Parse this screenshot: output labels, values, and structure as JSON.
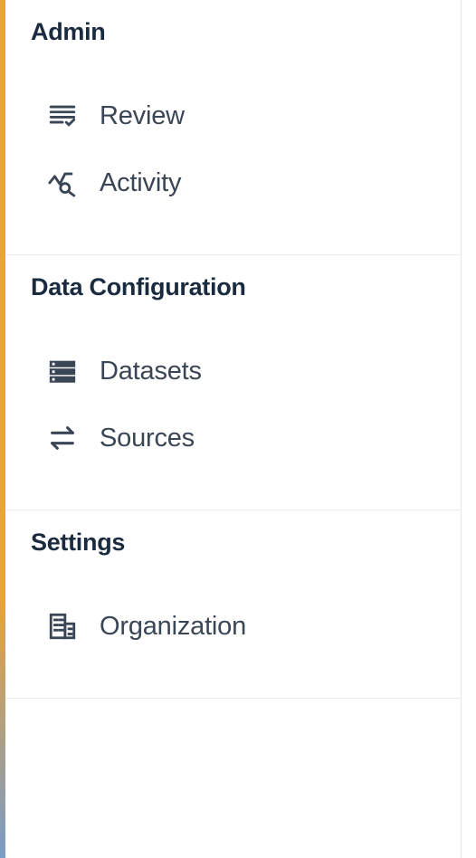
{
  "sections": [
    {
      "title": "Admin",
      "items": [
        {
          "label": "Review",
          "icon": "review-checklist-icon"
        },
        {
          "label": "Activity",
          "icon": "activity-search-icon"
        }
      ]
    },
    {
      "title": "Data Configuration",
      "items": [
        {
          "label": "Datasets",
          "icon": "storage-icon"
        },
        {
          "label": "Sources",
          "icon": "swap-arrows-icon"
        }
      ]
    },
    {
      "title": "Settings",
      "items": [
        {
          "label": "Organization",
          "icon": "organization-icon"
        }
      ]
    }
  ]
}
